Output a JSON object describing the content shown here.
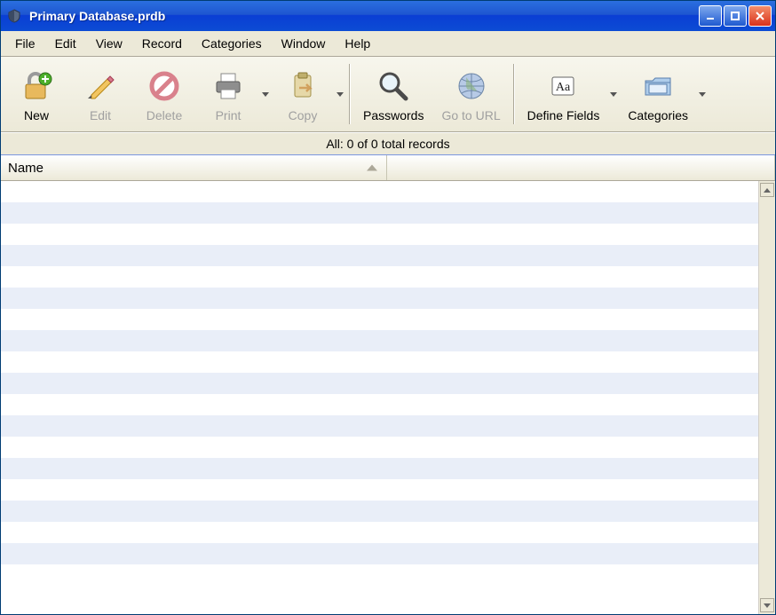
{
  "titlebar": {
    "title": "Primary Database.prdb"
  },
  "menubar": {
    "items": [
      "File",
      "Edit",
      "View",
      "Record",
      "Categories",
      "Window",
      "Help"
    ]
  },
  "toolbar": {
    "new_label": "New",
    "edit_label": "Edit",
    "delete_label": "Delete",
    "print_label": "Print",
    "copy_label": "Copy",
    "passwords_label": "Passwords",
    "gotourl_label": "Go to URL",
    "definefields_label": "Define Fields",
    "categories_label": "Categories"
  },
  "status": {
    "text": "All: 0 of 0 total records"
  },
  "columns": {
    "name_label": "Name"
  }
}
